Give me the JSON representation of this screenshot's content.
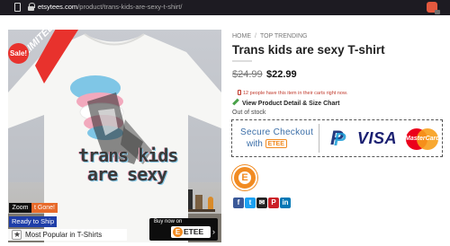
{
  "browser": {
    "url_host": "etsytees.com",
    "url_path": "/product/trans-kids-are-sexy-t-shirt/"
  },
  "product_image": {
    "design_line1": "trans kids",
    "design_line2": "are sexy",
    "limited_label": "LIMITED",
    "sale_badge": "Sale!",
    "zoom_label": "Zoom",
    "stock_tag": "t Gone!",
    "ready_to_ship": "Ready to Ship",
    "most_popular": "Most Popular in T-Shirts",
    "buy_now_label": "Buy now on",
    "buy_now_brand": "ETEE",
    "buy_now_brand_letter": "E",
    "buy_now_arrow": "›"
  },
  "breadcrumb": {
    "home": "HOME",
    "separator": "/",
    "category": "TOP TRENDING"
  },
  "product": {
    "title": "Trans kids are sexy T-shirt",
    "price_old": "$24.99",
    "price_new": "$22.99",
    "viewers_text": "12 people have this item in their carts right now.",
    "detail_link": "View Product Detail & Size Chart",
    "stock_status": "Out of stock"
  },
  "checkout": {
    "line1": "Secure Checkout",
    "line2_prefix": "with",
    "brand": "ETEE",
    "paypal_letter": "P",
    "visa_label": "VISA",
    "mastercard_label": "MasterCard"
  },
  "etee_badge_letter": "E",
  "share": {
    "facebook": "f",
    "twitter": "t",
    "email": "✉",
    "pinterest": "P",
    "linkedin": "in"
  },
  "colors": {
    "sale_red": "#e8322d",
    "brand_orange": "#f18b22",
    "checkout_blue": "#3b6ea8",
    "ready_blue": "#1f3ea8"
  }
}
